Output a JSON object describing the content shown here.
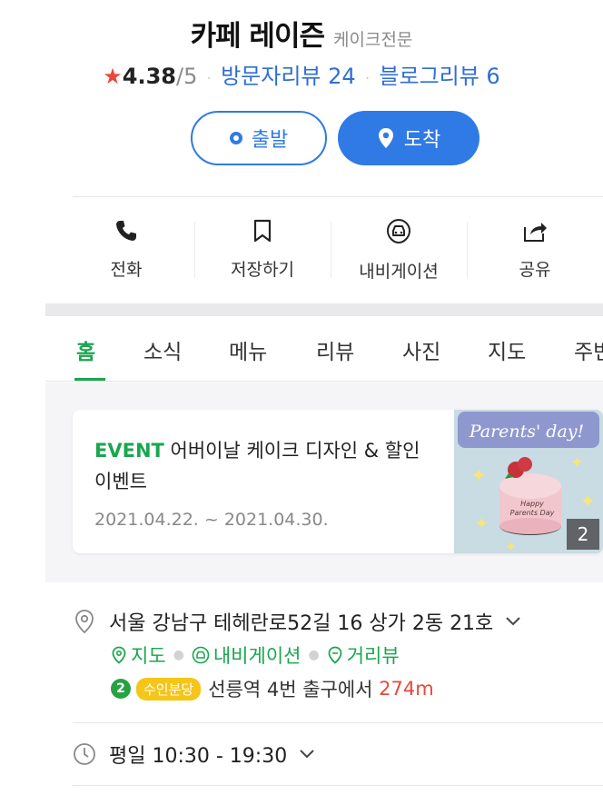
{
  "place": {
    "name": "카페 레이즌",
    "category": "케이크전문",
    "rating": "4.38",
    "rating_max": "/5",
    "visitor_reviews": "방문자리뷰 24",
    "blog_reviews": "블로그리뷰 6"
  },
  "route_buttons": {
    "start": "출발",
    "arrive": "도착"
  },
  "actions": [
    {
      "label": "전화",
      "icon": "phone-icon"
    },
    {
      "label": "저장하기",
      "icon": "bookmark-icon"
    },
    {
      "label": "내비게이션",
      "icon": "navigation-car-icon"
    },
    {
      "label": "공유",
      "icon": "share-icon"
    }
  ],
  "tabs": [
    "홈",
    "소식",
    "메뉴",
    "리뷰",
    "사진",
    "지도",
    "주변"
  ],
  "active_tab": "홈",
  "event": {
    "tag": "EVENT",
    "title": "어버이날 케이크 디자인 & 할인 이벤트",
    "date": "2021.04.22. ~ 2021.04.30.",
    "image_count": "2",
    "image_caption": "Parents' day!"
  },
  "info": {
    "address": "서울 강남구 테헤란로52길 16 상가 2동 21호",
    "links": [
      "지도",
      "내비게이션",
      "거리뷰"
    ],
    "subway_line_number": "2",
    "subway_line_name": "수인분당",
    "subway_text": "선릉역 4번 출구에서",
    "subway_distance": "274m",
    "hours": "평일 10:30 - 19:30"
  },
  "colors": {
    "primary_blue": "#2f7ae5",
    "green": "#1aa64f",
    "star_red": "#e8483c",
    "line2_green": "#27a243",
    "suin_yellow": "#f5c518"
  }
}
